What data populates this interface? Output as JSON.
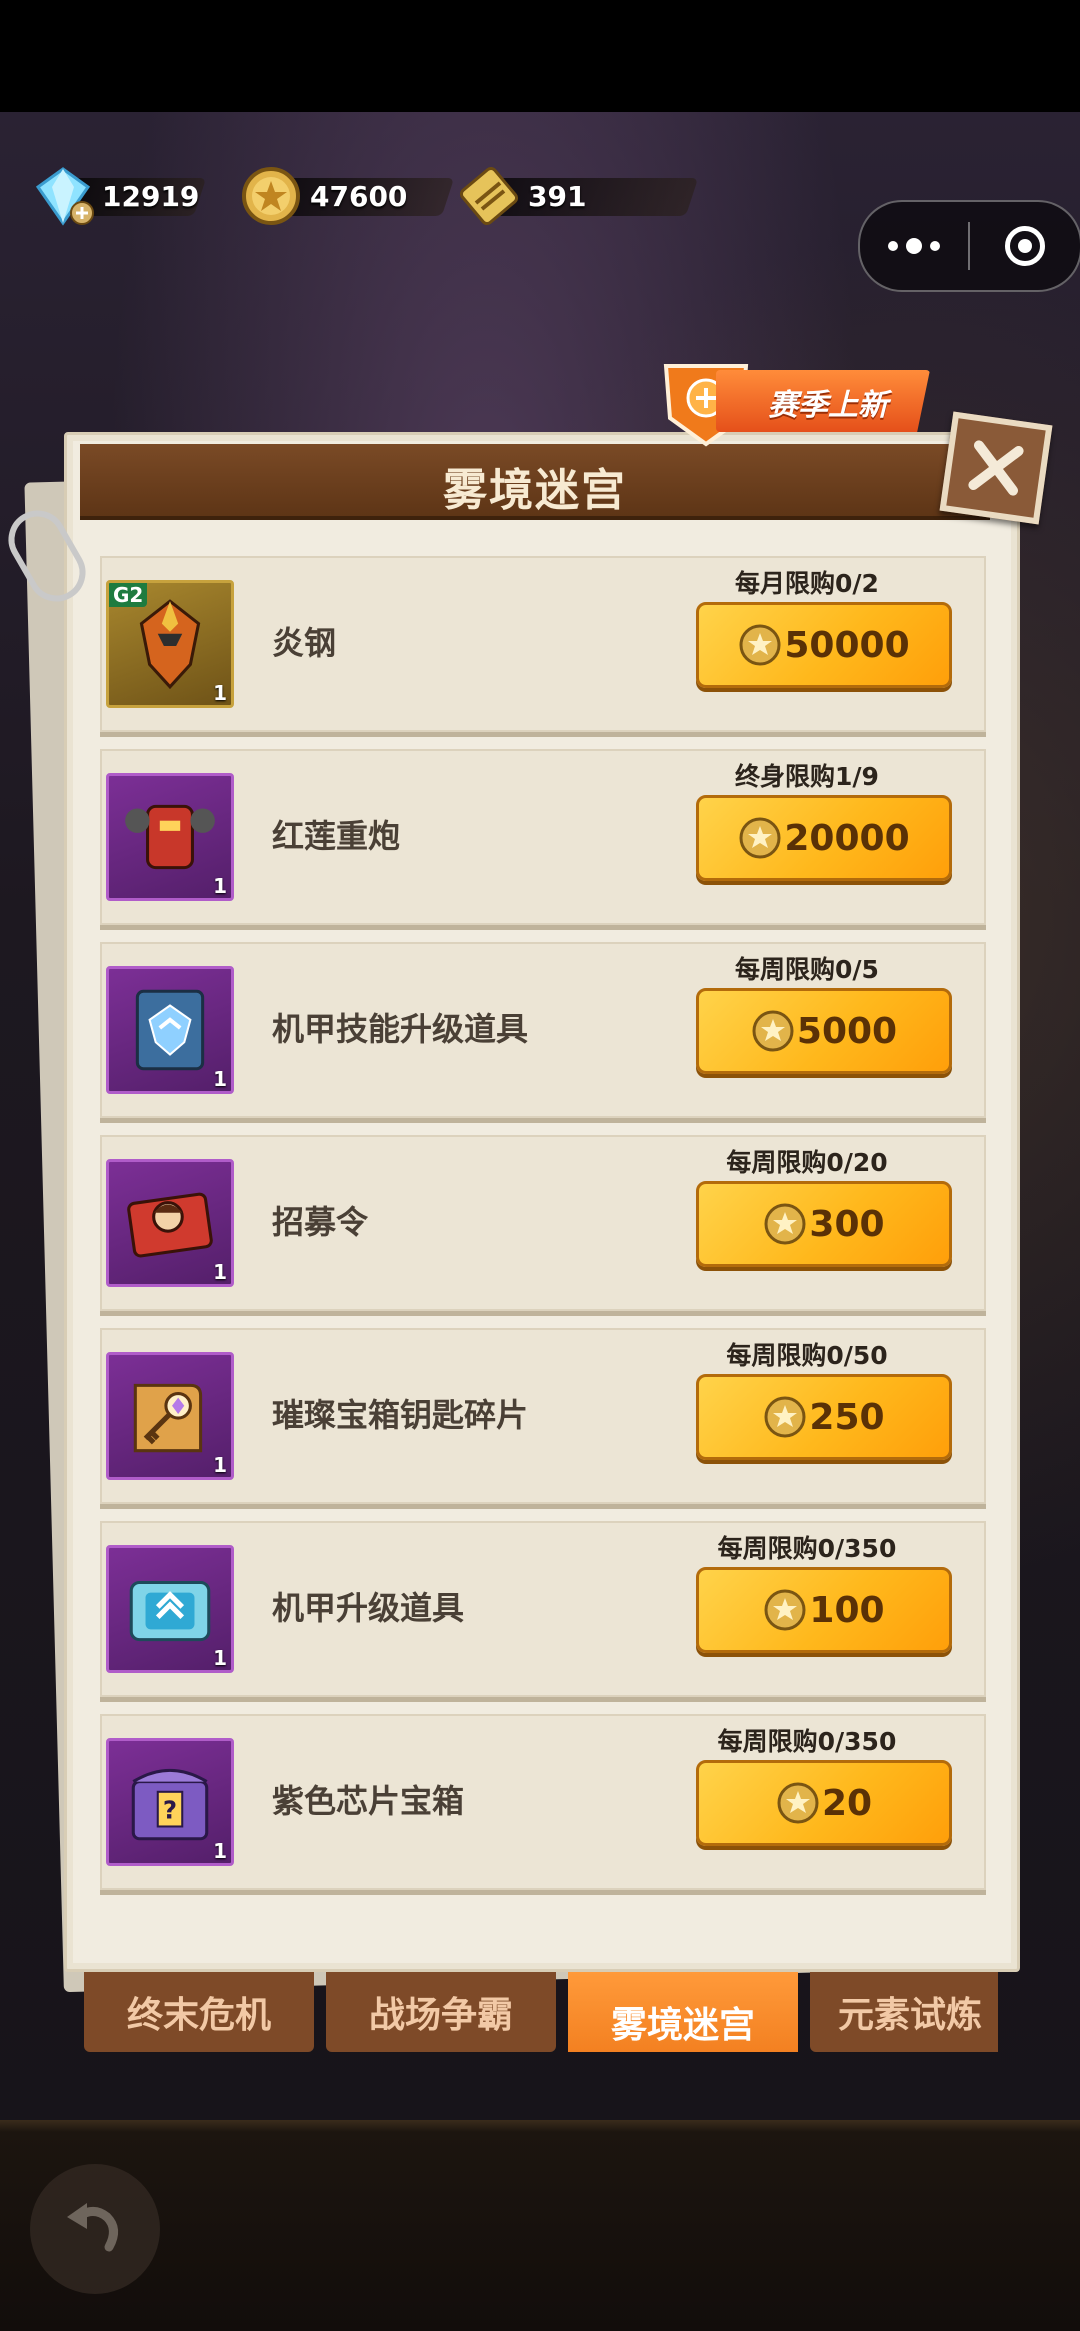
{
  "currency": [
    {
      "icon": "diamond-icon",
      "value": "12919"
    },
    {
      "icon": "gold-coin-icon",
      "value": "47600"
    },
    {
      "icon": "ticket-icon",
      "value": "391"
    }
  ],
  "badge": {
    "label": "赛季上新"
  },
  "panel": {
    "title": "雾境迷宫"
  },
  "items": [
    {
      "name": "炎钢",
      "limit": "每月限购0/2",
      "price": "50000",
      "qty": "1",
      "grade": "G2",
      "rarity": "gold"
    },
    {
      "name": "红莲重炮",
      "limit": "终身限购1/9",
      "price": "20000",
      "qty": "1",
      "rarity": "purple"
    },
    {
      "name": "机甲技能升级道具",
      "limit": "每周限购0/5",
      "price": "5000",
      "qty": "1",
      "rarity": "purple"
    },
    {
      "name": "招募令",
      "limit": "每周限购0/20",
      "price": "300",
      "qty": "1",
      "rarity": "purple"
    },
    {
      "name": "璀璨宝箱钥匙碎片",
      "limit": "每周限购0/50",
      "price": "250",
      "qty": "1",
      "rarity": "purple"
    },
    {
      "name": "机甲升级道具",
      "limit": "每周限购0/350",
      "price": "100",
      "qty": "1",
      "rarity": "purple"
    },
    {
      "name": "紫色芯片宝箱",
      "limit": "每周限购0/350",
      "price": "20",
      "qty": "1",
      "rarity": "purple"
    }
  ],
  "tabs": [
    {
      "label": "终末危机",
      "active": false
    },
    {
      "label": "战场争霸",
      "active": false
    },
    {
      "label": "雾境迷宫",
      "active": true
    },
    {
      "label": "元素试炼",
      "active": false
    }
  ]
}
